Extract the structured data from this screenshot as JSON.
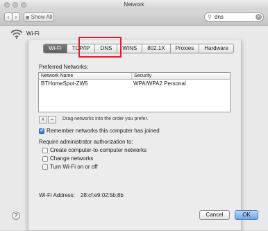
{
  "window": {
    "title": "Network"
  },
  "toolbar": {
    "show_all_label": "Show All",
    "search_value": "dns"
  },
  "section": {
    "title": "Wi-Fi"
  },
  "tabs": [
    {
      "label": "Wi-Fi",
      "active": true
    },
    {
      "label": "TCP/IP",
      "active": false
    },
    {
      "label": "DNS",
      "active": false
    },
    {
      "label": "WINS",
      "active": false
    },
    {
      "label": "802.1X",
      "active": false
    },
    {
      "label": "Proxies",
      "active": false
    },
    {
      "label": "Hardware",
      "active": false
    }
  ],
  "preferred": {
    "label": "Preferred Networks:",
    "columns": [
      "Network Name",
      "Security"
    ],
    "rows": [
      {
        "name": "BTHomeSpot-ZW5",
        "security": "WPA/WPA2 Personal"
      }
    ],
    "add_label": "+",
    "remove_label": "−",
    "drag_hint": "Drag networks into the order you prefer."
  },
  "remember": {
    "label": "Remember networks this computer has joined",
    "checked": true
  },
  "require": {
    "label": "Require administrator authorization to:",
    "options": [
      {
        "label": "Create computer-to-computer networks",
        "checked": false
      },
      {
        "label": "Change networks",
        "checked": false
      },
      {
        "label": "Turn Wi-Fi on or off",
        "checked": false
      }
    ]
  },
  "address": {
    "label": "Wi-Fi Address:",
    "value": "28:cf:e9:02:5b:8b"
  },
  "buttons": {
    "help": "?",
    "cancel": "Cancel",
    "ok": "OK"
  },
  "colors": {
    "highlight": "#e8192c",
    "active_tab": "#6b6b6b",
    "checkbox_on": "#3d7fe0"
  }
}
